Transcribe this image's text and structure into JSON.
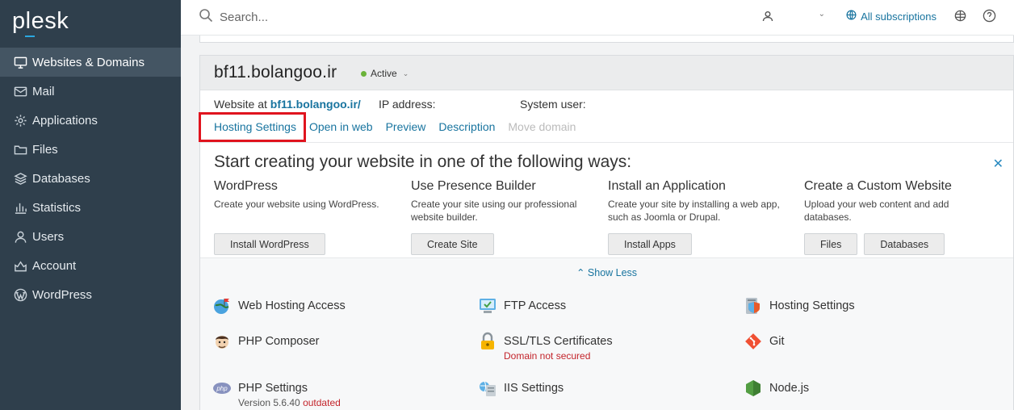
{
  "brand": {
    "logo_text": "plesk"
  },
  "sidebar": {
    "items": [
      {
        "label": "Websites & Domains",
        "icon": "monitor-icon",
        "active": true
      },
      {
        "label": "Mail",
        "icon": "mail-icon"
      },
      {
        "label": "Applications",
        "icon": "gear-icon"
      },
      {
        "label": "Files",
        "icon": "folder-icon"
      },
      {
        "label": "Databases",
        "icon": "database-icon"
      },
      {
        "label": "Statistics",
        "icon": "bar-chart-icon"
      },
      {
        "label": "Users",
        "icon": "user-icon"
      },
      {
        "label": "Account",
        "icon": "account-icon"
      },
      {
        "label": "WordPress",
        "icon": "wordpress-icon"
      }
    ],
    "collapse_label": "‹"
  },
  "topbar": {
    "search_placeholder": "Search...",
    "subscriptions_label": "All subscriptions"
  },
  "domain": {
    "name": "bf11.bolangoo.ir",
    "status": "Active",
    "website_at_label": "Website at",
    "website_link": "bf11.bolangoo.ir/",
    "ip_label": "IP address:",
    "system_user_label": "System user:",
    "links": {
      "hosting_settings": "Hosting Settings",
      "open_in_web": "Open in web",
      "preview": "Preview",
      "description": "Description",
      "move_domain": "Move domain"
    }
  },
  "start": {
    "title": "Start creating your website in one of the following ways:",
    "close_label": "✕",
    "ways": [
      {
        "title": "WordPress",
        "desc": "Create your website using WordPress.",
        "buttons": [
          "Install WordPress"
        ]
      },
      {
        "title": "Use Presence Builder",
        "desc": "Create your site using our professional website builder.",
        "buttons": [
          "Create Site"
        ]
      },
      {
        "title": "Install an Application",
        "desc": "Create your site by installing a web app, such as Joomla or Drupal.",
        "buttons": [
          "Install Apps"
        ]
      },
      {
        "title": "Create a Custom Website",
        "desc": "Upload your web content and add databases.",
        "buttons": [
          "Files",
          "Databases"
        ]
      }
    ]
  },
  "show_less": "Show Less",
  "tools": {
    "web_hosting_access": "Web Hosting Access",
    "ftp_access": "FTP Access",
    "hosting_settings": "Hosting Settings",
    "php_composer": "PHP Composer",
    "ssl_tls": "SSL/TLS Certificates",
    "ssl_status": "Domain not secured",
    "git": "Git",
    "php_settings": "PHP Settings",
    "php_version": "Version 5.6.40",
    "php_outdated": "outdated",
    "iis_settings": "IIS Settings",
    "nodejs": "Node.js",
    "php_badge": "php"
  },
  "colors": {
    "sidebar_bg": "#2f3f4c",
    "link": "#18749f",
    "active_dot": "#6bb33a",
    "highlight": "#e0141e",
    "warning": "#c3242b"
  }
}
